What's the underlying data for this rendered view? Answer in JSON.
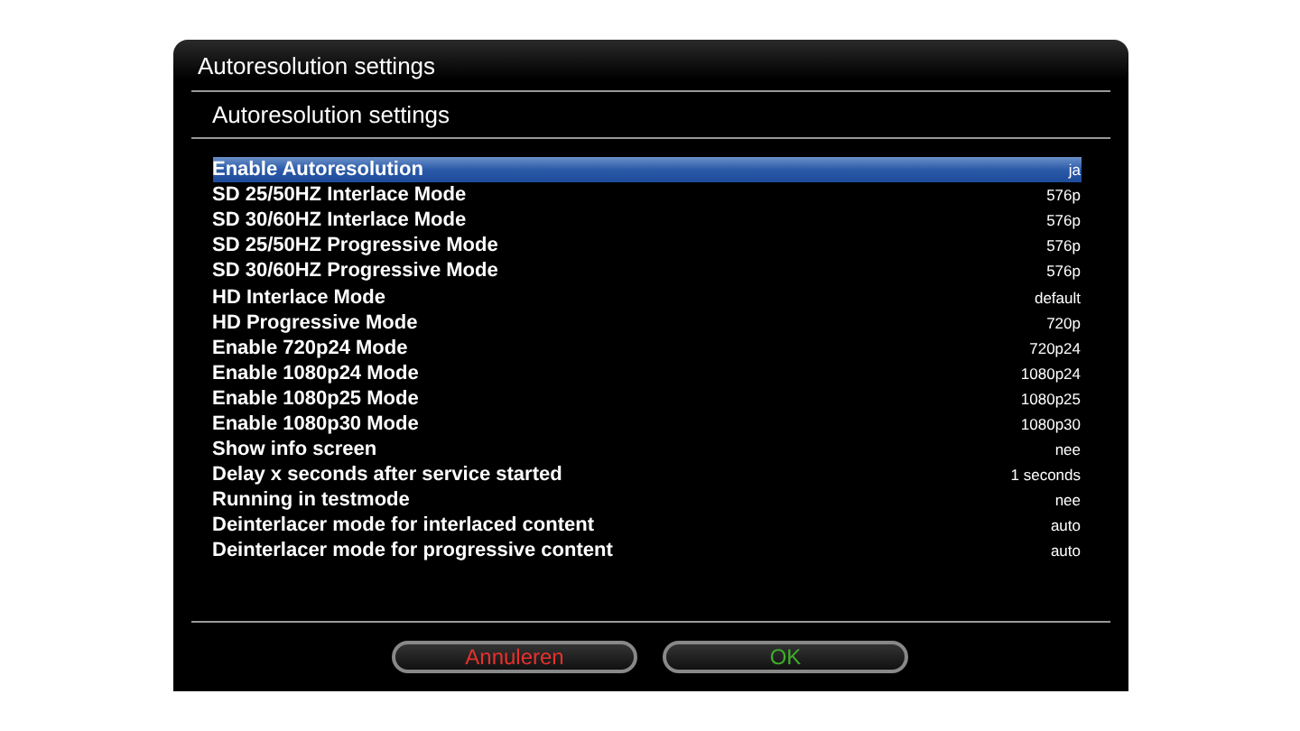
{
  "window": {
    "title": "Autoresolution settings"
  },
  "subtitle": "Autoresolution settings",
  "settings": [
    {
      "label": "Enable Autoresolution",
      "value": "ja",
      "selected": true
    },
    {
      "label": "SD 25/50HZ Interlace Mode",
      "value": "576p",
      "selected": false
    },
    {
      "label": "SD 30/60HZ Interlace Mode",
      "value": "576p",
      "selected": false
    },
    {
      "label": "SD 25/50HZ Progressive Mode",
      "value": "576p",
      "selected": false
    },
    {
      "label": "SD 30/60HZ Progressive Mode",
      "value": "576p",
      "selected": false
    },
    {
      "label": "HD Interlace Mode",
      "value": "default",
      "selected": false
    },
    {
      "label": "HD Progressive Mode",
      "value": "720p",
      "selected": false
    },
    {
      "label": "Enable 720p24 Mode",
      "value": "720p24",
      "selected": false
    },
    {
      "label": "Enable 1080p24 Mode",
      "value": "1080p24",
      "selected": false
    },
    {
      "label": "Enable 1080p25 Mode",
      "value": "1080p25",
      "selected": false
    },
    {
      "label": "Enable 1080p30 Mode",
      "value": "1080p30",
      "selected": false
    },
    {
      "label": "Show info screen",
      "value": "nee",
      "selected": false
    },
    {
      "label": "Delay x seconds after service started",
      "value": "1 seconds",
      "selected": false
    },
    {
      "label": "Running in testmode",
      "value": "nee",
      "selected": false
    },
    {
      "label": "Deinterlacer mode for interlaced content",
      "value": "auto",
      "selected": false
    },
    {
      "label": "Deinterlacer mode for progressive content",
      "value": "auto",
      "selected": false
    }
  ],
  "buttons": [
    {
      "label": "Annuleren",
      "kind": "cancel"
    },
    {
      "label": "OK",
      "kind": "confirm"
    }
  ]
}
